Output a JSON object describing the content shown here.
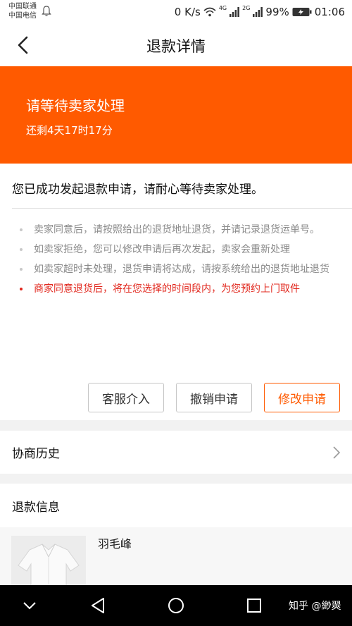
{
  "status_bar": {
    "carrier_1": "中国联通",
    "carrier_2": "中国电信",
    "speed": "0 K/s",
    "net_1": "4G",
    "net_2": "2G",
    "battery": "99%",
    "time": "01:06"
  },
  "nav": {
    "title": "退款详情"
  },
  "banner": {
    "title": "请等待卖家处理",
    "countdown": "还剩4天17时17分",
    "color": "#ff5a00"
  },
  "card": {
    "headline": "您已成功发起退款申请，请耐心等待卖家处理。",
    "tips": [
      "卖家同意后，请按照给出的退货地址退货，并请记录退货运单号。",
      "如卖家拒绝，您可以修改申请后再次发起，卖家会重新处理",
      "如卖家超时未处理，退货申请将达成，请按系统给出的退货地址退货",
      "商家同意退货后，将在您选择的时间段内，为您预约上门取件"
    ]
  },
  "buttons": {
    "service": "客服介入",
    "cancel": "撤销申请",
    "modify": "修改申请"
  },
  "history": {
    "label": "协商历史"
  },
  "refund_info": {
    "label": "退款信息",
    "product_name": "羽毛峰"
  },
  "watermark": "知乎 @緲翜"
}
